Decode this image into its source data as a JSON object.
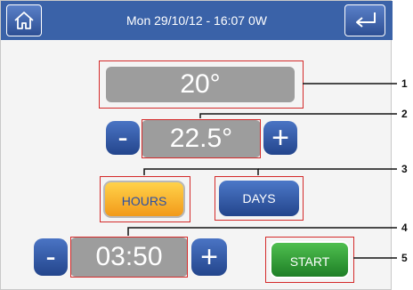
{
  "header": {
    "title": "Mon 29/10/12 - 16:07   0W",
    "home_icon": "home-icon",
    "back_icon": "back-arrow-icon"
  },
  "current_temperature": "20°",
  "setpoint": {
    "minus": "-",
    "value": "22.5°",
    "plus": "+"
  },
  "mode": {
    "hours_label": "HOURS",
    "days_label": "DAYS"
  },
  "timer": {
    "minus": "-",
    "value": "03:50",
    "plus": "+"
  },
  "start_label": "START",
  "callouts": [
    "1",
    "2",
    "3",
    "4",
    "5"
  ],
  "colors": {
    "header": "#3a62a8",
    "callout_line": "#d42a2a",
    "hours_active": "#f7b733",
    "start": "#2e9a36"
  }
}
